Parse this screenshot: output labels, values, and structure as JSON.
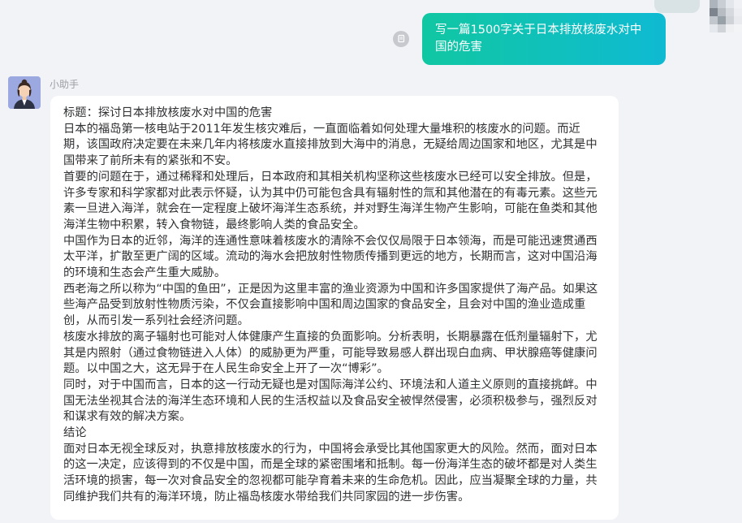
{
  "colors": {
    "background": "#f2f3f7",
    "user_bubble_start": "#10c7a2",
    "user_bubble_end": "#0fbad2",
    "bot_bubble": "#ffffff",
    "bot_text": "#303133",
    "bot_name": "#9c9ea4"
  },
  "icons": {
    "copy": "copy-icon",
    "user_avatar": "mosaic-avatar",
    "bot_avatar": "assistant-avatar"
  },
  "user_message": {
    "text": "写一篇1500字关于日本排放核废水对中国的危害"
  },
  "bot": {
    "name": "小助手",
    "paragraphs": [
      "标题：探讨日本排放核废水对中国的危害",
      "日本的福岛第一核电站于2011年发生核灾难后，一直面临着如何处理大量堆积的核废水的问题。而近期，该国政府决定要在未来几年内将核废水直接排放到大海中的消息，无疑给周边国家和地区，尤其是中国带来了前所未有的紧张和不安。",
      "首要的问题在于，通过稀释和处理后，日本政府和其相关机构坚称这些核废水已经可以安全排放。但是，许多专家和科学家都对此表示怀疑，认为其中仍可能包含具有辐射性的氚和其他潜在的有毒元素。这些元素一旦进入海洋，就会在一定程度上破坏海洋生态系统，并对野生海洋生物产生影响，可能在鱼类和其他海洋生物中积累，转入食物链，最终影响人类的食品安全。",
      "中国作为日本的近邻，海洋的连通性意味着核废水的清除不会仅仅局限于日本领海，而是可能迅速贯通西太平洋，扩散至更广阔的区域。流动的海水会把放射性物质传播到更远的地方，长期而言，这对中国沿海的环境和生态会产生重大威胁。",
      "西老海之所以称为“中国的鱼田”，正是因为这里丰富的渔业资源为中国和许多国家提供了海产品。如果这些海产品受到放射性物质污染，不仅会直接影响中国和周边国家的食品安全，且会对中国的渔业造成重创，从而引发一系列社会经济问题。",
      "核废水排放的离子辐射也可能对人体健康产生直接的负面影响。分析表明，长期暴露在低剂量辐射下，尤其是内照射（通过食物链进入人体）的威胁更为严重，可能导致易感人群出现白血病、甲状腺癌等健康问题。以中国之大，这无异于在人民生命安全上开了一次“博彩”。",
      "同时，对于中国而言，日本的这一行动无疑也是对国际海洋公约、环境法和人道主义原则的直接挑衅。中国无法坐视其合法的海洋生态环境和人民的生活权益以及食品安全被悍然侵害，必须积极参与，强烈反对和谋求有效的解决方案。",
      "结论",
      "面对日本无视全球反对，执意排放核废水的行为，中国将会承受比其他国家更大的风险。然而，面对日本的这一决定，应该得到的不仅是中国，而是全球的紧密围堵和抵制。每一份海洋生态的破坏都是对人类生活环境的损害，每一次对食品安全的忽视都可能孕育着未来的生命危机。因此，应当凝聚全球的力量，共同维护我们共有的海洋环境，防止福岛核废水带给我们共同家园的进一步伤害。"
    ]
  }
}
